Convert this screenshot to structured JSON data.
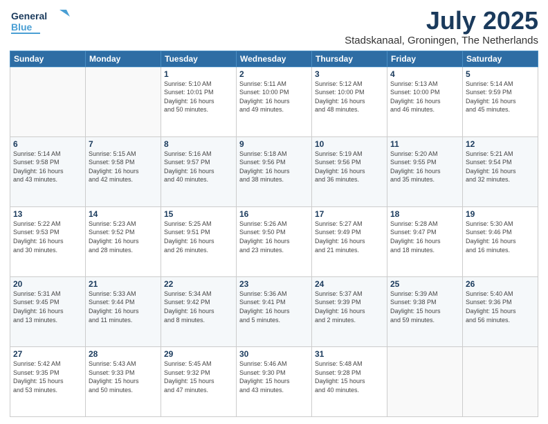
{
  "header": {
    "logo_general": "General",
    "logo_blue": "Blue",
    "month_title": "July 2025",
    "subtitle": "Stadskanaal, Groningen, The Netherlands"
  },
  "days_of_week": [
    "Sunday",
    "Monday",
    "Tuesday",
    "Wednesday",
    "Thursday",
    "Friday",
    "Saturday"
  ],
  "weeks": [
    [
      {
        "day": "",
        "info": ""
      },
      {
        "day": "",
        "info": ""
      },
      {
        "day": "1",
        "info": "Sunrise: 5:10 AM\nSunset: 10:01 PM\nDaylight: 16 hours\nand 50 minutes."
      },
      {
        "day": "2",
        "info": "Sunrise: 5:11 AM\nSunset: 10:00 PM\nDaylight: 16 hours\nand 49 minutes."
      },
      {
        "day": "3",
        "info": "Sunrise: 5:12 AM\nSunset: 10:00 PM\nDaylight: 16 hours\nand 48 minutes."
      },
      {
        "day": "4",
        "info": "Sunrise: 5:13 AM\nSunset: 10:00 PM\nDaylight: 16 hours\nand 46 minutes."
      },
      {
        "day": "5",
        "info": "Sunrise: 5:14 AM\nSunset: 9:59 PM\nDaylight: 16 hours\nand 45 minutes."
      }
    ],
    [
      {
        "day": "6",
        "info": "Sunrise: 5:14 AM\nSunset: 9:58 PM\nDaylight: 16 hours\nand 43 minutes."
      },
      {
        "day": "7",
        "info": "Sunrise: 5:15 AM\nSunset: 9:58 PM\nDaylight: 16 hours\nand 42 minutes."
      },
      {
        "day": "8",
        "info": "Sunrise: 5:16 AM\nSunset: 9:57 PM\nDaylight: 16 hours\nand 40 minutes."
      },
      {
        "day": "9",
        "info": "Sunrise: 5:18 AM\nSunset: 9:56 PM\nDaylight: 16 hours\nand 38 minutes."
      },
      {
        "day": "10",
        "info": "Sunrise: 5:19 AM\nSunset: 9:56 PM\nDaylight: 16 hours\nand 36 minutes."
      },
      {
        "day": "11",
        "info": "Sunrise: 5:20 AM\nSunset: 9:55 PM\nDaylight: 16 hours\nand 35 minutes."
      },
      {
        "day": "12",
        "info": "Sunrise: 5:21 AM\nSunset: 9:54 PM\nDaylight: 16 hours\nand 32 minutes."
      }
    ],
    [
      {
        "day": "13",
        "info": "Sunrise: 5:22 AM\nSunset: 9:53 PM\nDaylight: 16 hours\nand 30 minutes."
      },
      {
        "day": "14",
        "info": "Sunrise: 5:23 AM\nSunset: 9:52 PM\nDaylight: 16 hours\nand 28 minutes."
      },
      {
        "day": "15",
        "info": "Sunrise: 5:25 AM\nSunset: 9:51 PM\nDaylight: 16 hours\nand 26 minutes."
      },
      {
        "day": "16",
        "info": "Sunrise: 5:26 AM\nSunset: 9:50 PM\nDaylight: 16 hours\nand 23 minutes."
      },
      {
        "day": "17",
        "info": "Sunrise: 5:27 AM\nSunset: 9:49 PM\nDaylight: 16 hours\nand 21 minutes."
      },
      {
        "day": "18",
        "info": "Sunrise: 5:28 AM\nSunset: 9:47 PM\nDaylight: 16 hours\nand 18 minutes."
      },
      {
        "day": "19",
        "info": "Sunrise: 5:30 AM\nSunset: 9:46 PM\nDaylight: 16 hours\nand 16 minutes."
      }
    ],
    [
      {
        "day": "20",
        "info": "Sunrise: 5:31 AM\nSunset: 9:45 PM\nDaylight: 16 hours\nand 13 minutes."
      },
      {
        "day": "21",
        "info": "Sunrise: 5:33 AM\nSunset: 9:44 PM\nDaylight: 16 hours\nand 11 minutes."
      },
      {
        "day": "22",
        "info": "Sunrise: 5:34 AM\nSunset: 9:42 PM\nDaylight: 16 hours\nand 8 minutes."
      },
      {
        "day": "23",
        "info": "Sunrise: 5:36 AM\nSunset: 9:41 PM\nDaylight: 16 hours\nand 5 minutes."
      },
      {
        "day": "24",
        "info": "Sunrise: 5:37 AM\nSunset: 9:39 PM\nDaylight: 16 hours\nand 2 minutes."
      },
      {
        "day": "25",
        "info": "Sunrise: 5:39 AM\nSunset: 9:38 PM\nDaylight: 15 hours\nand 59 minutes."
      },
      {
        "day": "26",
        "info": "Sunrise: 5:40 AM\nSunset: 9:36 PM\nDaylight: 15 hours\nand 56 minutes."
      }
    ],
    [
      {
        "day": "27",
        "info": "Sunrise: 5:42 AM\nSunset: 9:35 PM\nDaylight: 15 hours\nand 53 minutes."
      },
      {
        "day": "28",
        "info": "Sunrise: 5:43 AM\nSunset: 9:33 PM\nDaylight: 15 hours\nand 50 minutes."
      },
      {
        "day": "29",
        "info": "Sunrise: 5:45 AM\nSunset: 9:32 PM\nDaylight: 15 hours\nand 47 minutes."
      },
      {
        "day": "30",
        "info": "Sunrise: 5:46 AM\nSunset: 9:30 PM\nDaylight: 15 hours\nand 43 minutes."
      },
      {
        "day": "31",
        "info": "Sunrise: 5:48 AM\nSunset: 9:28 PM\nDaylight: 15 hours\nand 40 minutes."
      },
      {
        "day": "",
        "info": ""
      },
      {
        "day": "",
        "info": ""
      }
    ]
  ]
}
